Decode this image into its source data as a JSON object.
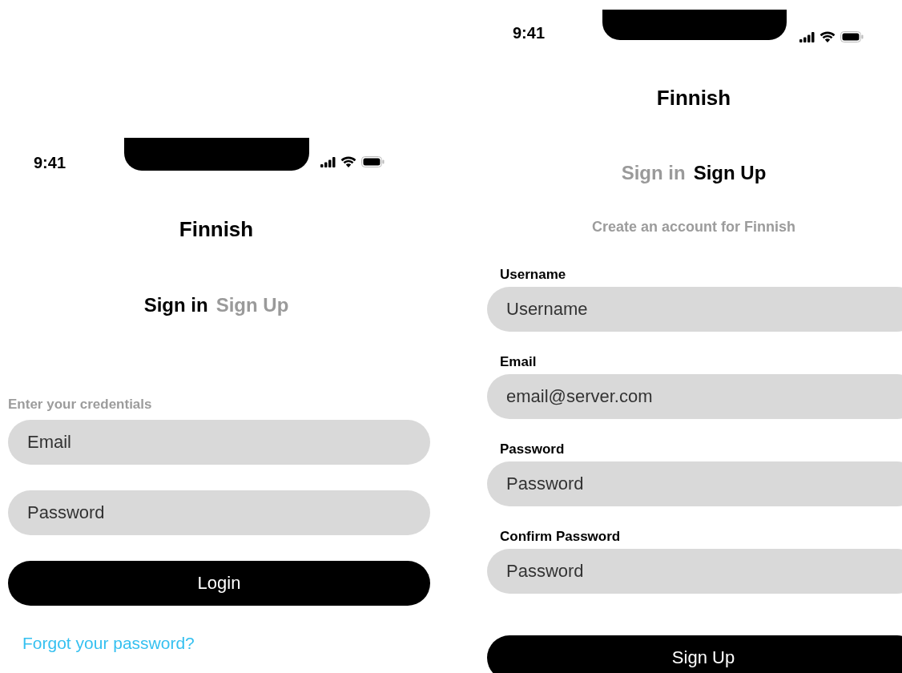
{
  "screens": [
    {
      "kind": "sign_in",
      "time": "9:41",
      "title": "Finnish",
      "tabs": [
        {
          "label": "Sign in",
          "selected": true
        },
        {
          "label": "Sign Up",
          "selected": false
        }
      ],
      "prompt": "Enter your credentials",
      "fields": [
        {
          "placeholder": "Email"
        },
        {
          "placeholder": "Password"
        }
      ],
      "button": "Login",
      "link": "Forgot your password?"
    },
    {
      "kind": "sign_up",
      "time": "9:41",
      "title": "Finnish",
      "tabs": [
        {
          "label": "Sign in",
          "selected": false
        },
        {
          "label": "Sign Up",
          "selected": true
        }
      ],
      "prompt": "Create an account for Finnish",
      "fields": [
        {
          "label": "Username",
          "placeholder": "Username"
        },
        {
          "label": "Email",
          "placeholder": "email@server.com"
        },
        {
          "label": "Password",
          "placeholder": "Password"
        },
        {
          "label": "Confirm Password",
          "placeholder": "Password"
        }
      ],
      "button": "Sign Up"
    }
  ]
}
